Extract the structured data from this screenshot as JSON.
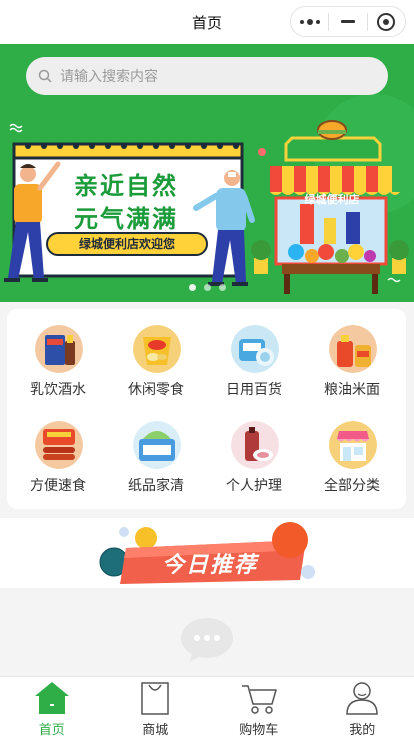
{
  "navbar": {
    "title": "首页"
  },
  "search": {
    "placeholder": "请输入搜索内容"
  },
  "banner": {
    "headline_1": "亲近自然",
    "headline_2": "元气满满",
    "tagline": "绿城便利店欢迎您",
    "store_sign": "绿城便利店",
    "slide_count": 3,
    "active_slide": 1
  },
  "categories": [
    {
      "label": "乳饮酒水",
      "icon": "drinks-icon"
    },
    {
      "label": "休闲零食",
      "icon": "snacks-icon"
    },
    {
      "label": "日用百货",
      "icon": "daily-goods-icon"
    },
    {
      "label": "粮油米面",
      "icon": "grain-oil-icon"
    },
    {
      "label": "方便速食",
      "icon": "instant-food-icon"
    },
    {
      "label": "纸品家清",
      "icon": "paper-cleaning-icon"
    },
    {
      "label": "个人护理",
      "icon": "personal-care-icon"
    },
    {
      "label": "全部分类",
      "icon": "all-categories-icon"
    }
  ],
  "recommend": {
    "title": "今日推荐"
  },
  "tabbar": {
    "items": [
      {
        "label": "首页",
        "icon": "home-icon",
        "active": true
      },
      {
        "label": "商城",
        "icon": "shop-bag-icon",
        "active": false
      },
      {
        "label": "购物车",
        "icon": "cart-icon",
        "active": false
      },
      {
        "label": "我的",
        "icon": "user-icon",
        "active": false
      }
    ]
  },
  "colors": {
    "brand_green": "#2fae48",
    "banner_bg": "#2fae48",
    "page_bg": "#f4f4f4",
    "recommend_red": "#f0604a"
  }
}
